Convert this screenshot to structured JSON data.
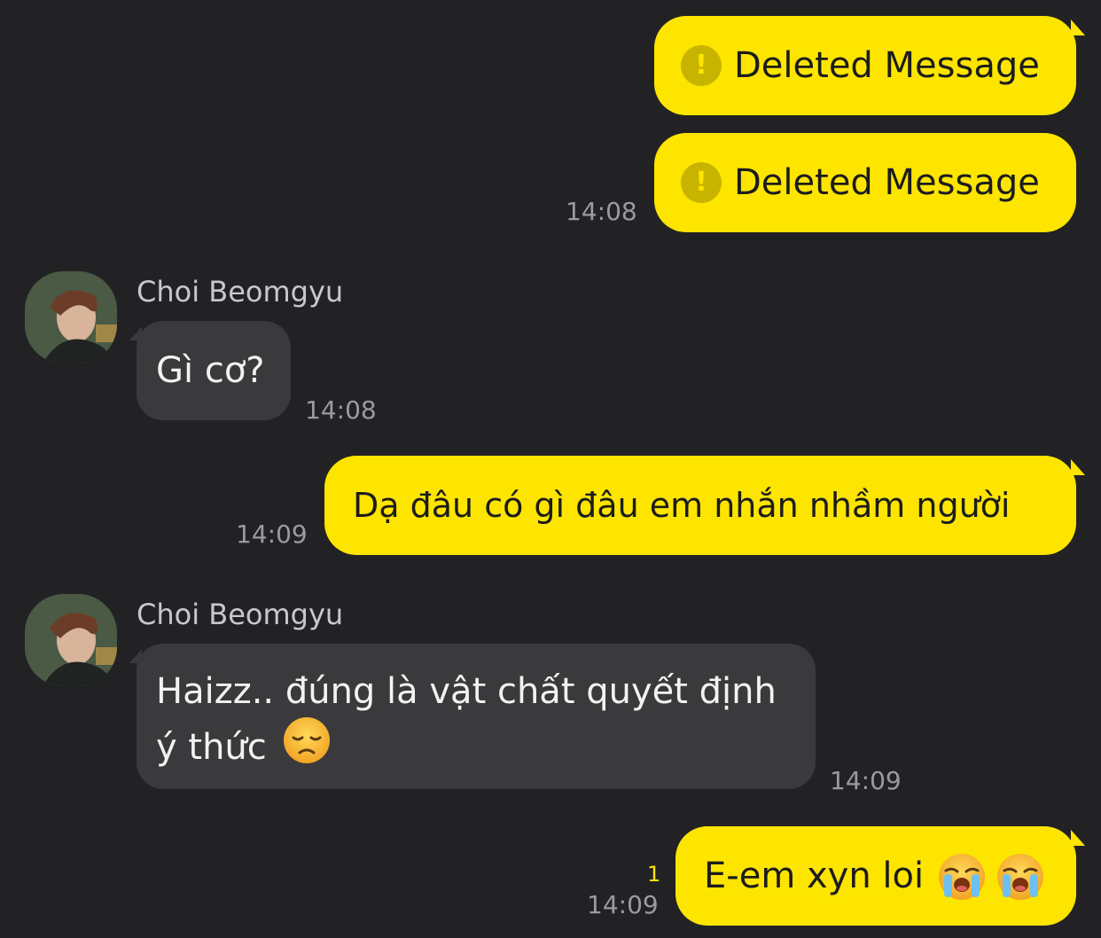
{
  "messages": {
    "m1": {
      "icon": "exclamation-circle-icon",
      "text": "Deleted Message"
    },
    "m2": {
      "icon": "exclamation-circle-icon",
      "text": "Deleted Message",
      "time": "14:08"
    },
    "m3": {
      "sender": "Choi Beomgyu",
      "avatar": "profile-photo",
      "text": "Gì cơ?",
      "time": "14:08"
    },
    "m4": {
      "text": "Dạ đâu có gì đâu em nhắn nhầm người",
      "time": "14:09"
    },
    "m5": {
      "sender": "Choi Beomgyu",
      "avatar": "profile-photo",
      "line1": "Haizz.. đúng là vật chất quyết định",
      "line2": "ý thức",
      "emoji": "disappointed-face-emoji",
      "time": "14:09"
    },
    "m6": {
      "text": "E-em xyn loi",
      "emoji": "loudly-crying-face-emoji",
      "unread": "1",
      "time": "14:09"
    }
  },
  "colors": {
    "background": "#222225",
    "my_bubble": "#fde500",
    "other_bubble": "#3a3a3d",
    "timestamp": "#9a9aa0",
    "unread_count": "#fde500"
  }
}
